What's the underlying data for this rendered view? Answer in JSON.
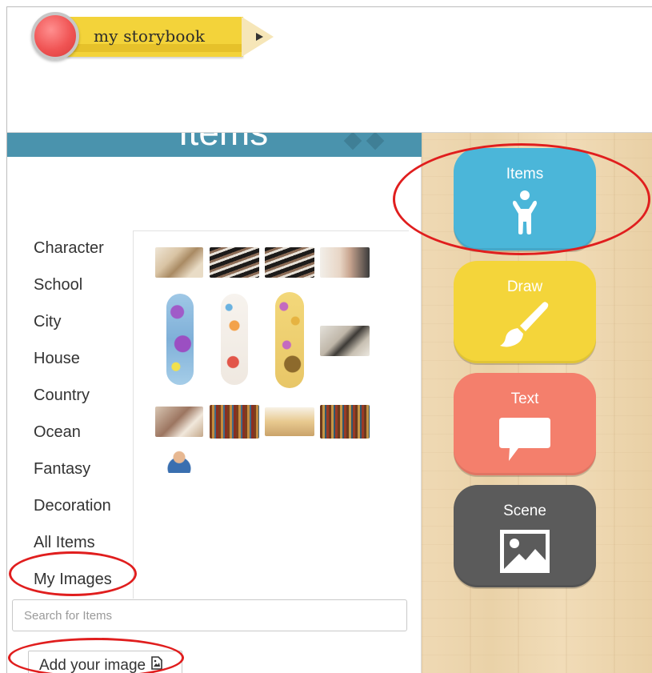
{
  "app": {
    "logo_text": "my storybook"
  },
  "panel": {
    "title": "Items"
  },
  "categories": [
    {
      "label": "Character"
    },
    {
      "label": "School"
    },
    {
      "label": "City"
    },
    {
      "label": "House"
    },
    {
      "label": "Country"
    },
    {
      "label": "Ocean"
    },
    {
      "label": "Fantasy"
    },
    {
      "label": "Decoration"
    },
    {
      "label": "All Items"
    },
    {
      "label": "My Images"
    }
  ],
  "search": {
    "placeholder": "Search for Items",
    "value": ""
  },
  "add_image": {
    "label": "Add your image"
  },
  "tools": [
    {
      "label": "Items",
      "icon": "person-icon",
      "color": "#4bb6d9"
    },
    {
      "label": "Draw",
      "icon": "paintbrush-icon",
      "color": "#f4d53a"
    },
    {
      "label": "Text",
      "icon": "speech-bubble-icon",
      "color": "#f47f6c"
    },
    {
      "label": "Scene",
      "icon": "image-icon",
      "color": "#5b5b5b"
    }
  ],
  "colors": {
    "header_bar": "#4a93ad",
    "annotation": "#e01e1e",
    "wood": "#ead2a8"
  }
}
